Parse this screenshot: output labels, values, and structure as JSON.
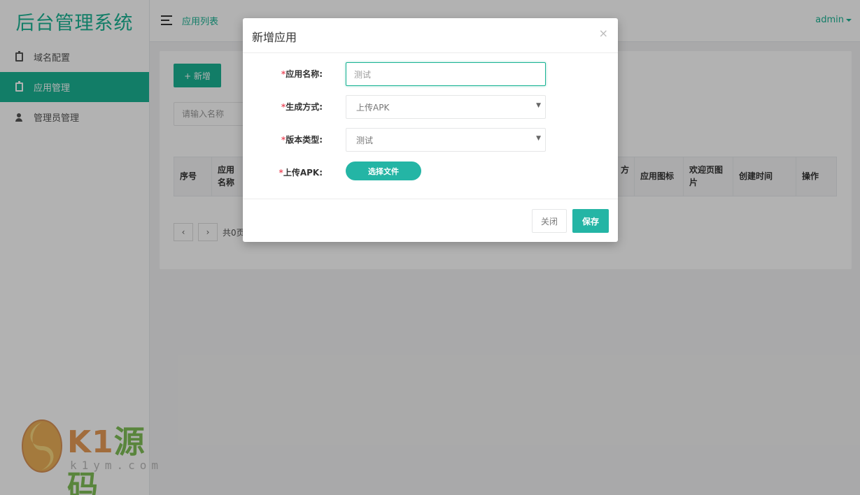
{
  "app": {
    "title": "后台管理系统",
    "breadcrumb": "应用列表",
    "user": "admin"
  },
  "sidebar": {
    "items": [
      {
        "label": "域名配置",
        "icon": "clipboard-icon",
        "active": false
      },
      {
        "label": "应用管理",
        "icon": "clipboard-icon",
        "active": true
      },
      {
        "label": "管理员管理",
        "icon": "user-icon",
        "active": false
      }
    ]
  },
  "main": {
    "add_button": "+ 新增",
    "search_placeholder": "请输入名称",
    "table": {
      "columns": [
        "序号",
        "应用名称",
        "方",
        "应用图标",
        "欢迎页图片",
        "创建时间",
        "操作"
      ]
    },
    "pager": {
      "prev": "‹",
      "next": "›",
      "summary": "共0页"
    }
  },
  "modal": {
    "title": "新增应用",
    "close_glyph": "×",
    "fields": {
      "app_name": {
        "label": "应用名称:",
        "required_mark": "*",
        "value": "测试"
      },
      "gen_method": {
        "label": "生成方式:",
        "required_mark": "*",
        "selected": "上传APK"
      },
      "version_type": {
        "label": "版本类型:",
        "required_mark": "*",
        "selected": "测试"
      },
      "upload_apk": {
        "label": "上传APK:",
        "required_mark": "*",
        "button": "选择文件"
      }
    },
    "footer": {
      "close_label": "关闭",
      "save_label": "保存"
    }
  },
  "watermark": {
    "brand_left": "K1",
    "brand_right": "源码",
    "domain": "k1ym.com"
  },
  "colors": {
    "brand": "#1ab394",
    "accent": "#24b5a5",
    "required": "#ed5565"
  }
}
